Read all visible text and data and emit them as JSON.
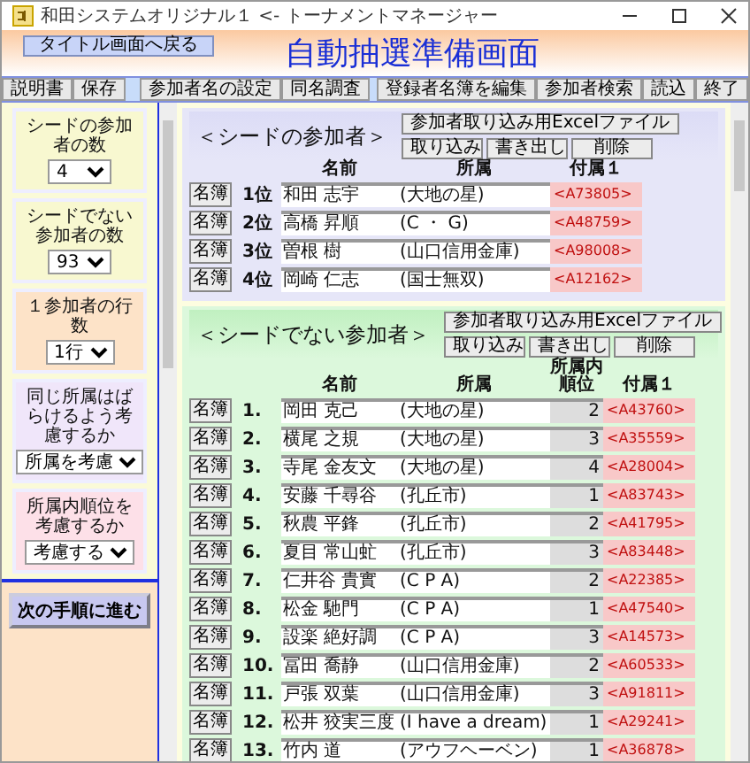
{
  "window": {
    "title": "和田システムオリジナル１ <- トーナメントマネージャー"
  },
  "header": {
    "back_button": "タイトル画面へ戻る",
    "title": "自動抽選準備画面"
  },
  "toolbar": {
    "left": [
      "説明書",
      "保存"
    ],
    "middle": [
      "参加者名の設定",
      "同名調査"
    ],
    "right": [
      "登録者名簿を編集",
      "参加者検索",
      "読込",
      "終了"
    ]
  },
  "settings": [
    {
      "label": "シードの参加者の数",
      "value": "4",
      "color": "#f8f8d0"
    },
    {
      "label": "シードでない参加者の数",
      "value": "93",
      "color": "#f8f8d0"
    },
    {
      "label": "１参加者の行数",
      "value": "1行",
      "color": "#fde3c8"
    },
    {
      "label": "同じ所属はばらけるよう考慮するか",
      "value": "所属を考慮",
      "color": "#f0e6fa"
    },
    {
      "label": "所属内順位を考慮するか",
      "value": "考慮する",
      "color": "#fde0e8"
    }
  ],
  "next_button": "次の手順に進む",
  "seeded": {
    "title": "＜シードの参加者＞",
    "excel_button": "参加者取り込み用Excelファイル",
    "buttons": [
      "取り込み",
      "書き出し",
      "削除"
    ],
    "columns": [
      "名前",
      "所属",
      "付属１"
    ],
    "rows": [
      {
        "button": "名簿",
        "number": "1位",
        "name": "和田 志宇",
        "affiliation": "(大地の星)",
        "tag": "<A73805>"
      },
      {
        "button": "名簿",
        "number": "2位",
        "name": "高橋 昇順",
        "affiliation": "(C ・ G)",
        "tag": "<A48759>"
      },
      {
        "button": "名簿",
        "number": "3位",
        "name": "曽根 樹",
        "affiliation": "(山口信用金庫)",
        "tag": "<A98008>"
      },
      {
        "button": "名簿",
        "number": "4位",
        "name": "岡崎 仁志",
        "affiliation": "(国士無双)",
        "tag": "<A12162>"
      }
    ]
  },
  "nonseeded": {
    "title": "＜シードでない参加者＞",
    "excel_button": "参加者取り込み用Excelファイル",
    "buttons": [
      "取り込み",
      "書き出し",
      "削除"
    ],
    "columns": [
      "名前",
      "所属",
      "所属内順位",
      "付属１"
    ],
    "rows": [
      {
        "button": "名簿",
        "number": "1.",
        "name": "岡田 克己",
        "affiliation": "(大地の星)",
        "rank": "2",
        "tag": "<A43760>"
      },
      {
        "button": "名簿",
        "number": "2.",
        "name": "横尾 之規",
        "affiliation": "(大地の星)",
        "rank": "3",
        "tag": "<A35559>"
      },
      {
        "button": "名簿",
        "number": "3.",
        "name": "寺尾 金友文",
        "affiliation": "(大地の星)",
        "rank": "4",
        "tag": "<A28004>"
      },
      {
        "button": "名簿",
        "number": "4.",
        "name": "安藤 千尋谷",
        "affiliation": "(孔丘市)",
        "rank": "1",
        "tag": "<A83743>"
      },
      {
        "button": "名簿",
        "number": "5.",
        "name": "秋農 平鋒",
        "affiliation": "(孔丘市)",
        "rank": "2",
        "tag": "<A41795>"
      },
      {
        "button": "名簿",
        "number": "6.",
        "name": "夏目 常山虻",
        "affiliation": "(孔丘市)",
        "rank": "3",
        "tag": "<A83448>"
      },
      {
        "button": "名簿",
        "number": "7.",
        "name": "仁井谷 貴實",
        "affiliation": "(C P A)",
        "rank": "2",
        "tag": "<A22385>"
      },
      {
        "button": "名簿",
        "number": "8.",
        "name": "松金 馳門",
        "affiliation": "(C P A)",
        "rank": "1",
        "tag": "<A47540>"
      },
      {
        "button": "名簿",
        "number": "9.",
        "name": "設楽 絶好調",
        "affiliation": "(C P A)",
        "rank": "3",
        "tag": "<A14573>"
      },
      {
        "button": "名簿",
        "number": "10.",
        "name": "冨田 喬静",
        "affiliation": "(山口信用金庫)",
        "rank": "2",
        "tag": "<A60533>"
      },
      {
        "button": "名簿",
        "number": "11.",
        "name": "戸張 双葉",
        "affiliation": "(山口信用金庫)",
        "rank": "3",
        "tag": "<A91811>"
      },
      {
        "button": "名簿",
        "number": "12.",
        "name": "松井 狡実三度",
        "affiliation": "(I have a dream)",
        "rank": "1",
        "tag": "<A29241>"
      },
      {
        "button": "名簿",
        "number": "13.",
        "name": "竹内 道",
        "affiliation": "(アウフヘーベン)",
        "rank": "1",
        "tag": "<A36878>"
      }
    ]
  }
}
